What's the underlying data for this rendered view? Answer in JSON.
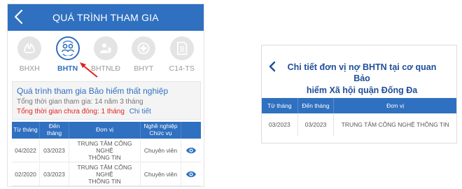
{
  "left_panel": {
    "header": {
      "title": "QUÁ TRÌNH THAM GIA"
    },
    "tabs": [
      {
        "label": "BHXH",
        "icon": "hands-icon",
        "active": false
      },
      {
        "label": "BHTN",
        "icon": "people-exchange-icon",
        "active": true
      },
      {
        "label": "BHTNLĐ",
        "icon": "shield-person-icon",
        "active": false
      },
      {
        "label": "BHYT",
        "icon": "medical-cross-icon",
        "active": false
      },
      {
        "label": "C14-TS",
        "icon": "document-icon",
        "active": false
      }
    ],
    "info": {
      "title": "Quá trình tham gia Bảo hiểm thất nghiệp",
      "total_time": "Tổng thời gian tham gia: 14 năm 3 tháng",
      "unpaid": "Tổng thời gian chưa đóng: 1 tháng",
      "detail_link": "Chi tiết"
    },
    "table": {
      "headers": {
        "from": "Từ tháng",
        "to_line1": "Đến",
        "to_line2": "tháng",
        "unit": "Đơn vị",
        "job_line1": "Nghề nghiệp",
        "job_line2": "Chức vụ"
      },
      "rows": [
        {
          "from": "04/2022",
          "to": "03/2023",
          "unit_line1": "TRUNG TÂM CÔNG NGHỆ",
          "unit_line2": "THÔNG TIN",
          "position": "Chuyên viên"
        },
        {
          "from": "02/2020",
          "to": "03/2023",
          "unit_line1": "TRUNG TÂM CÔNG NGHỆ",
          "unit_line2": "THÔNG TIN",
          "position": "Chuyên viên"
        }
      ]
    }
  },
  "right_panel": {
    "title_line1": "Chi tiết đơn vị nợ BHTN tại cơ quan Bảo",
    "title_line2": "hiểm Xã hội quận Đống Đa",
    "table": {
      "headers": {
        "from": "Từ tháng",
        "to": "Đến tháng",
        "unit": "Đơn vị"
      },
      "rows": [
        {
          "from": "03/2023",
          "to": "03/2023",
          "unit": "TRUNG TÂM CÔNG NGHỆ THÔNG TIN"
        }
      ]
    }
  },
  "colors": {
    "primary": "#2f70c0",
    "alert": "#e02424",
    "title_dark": "#1f4e9a"
  }
}
